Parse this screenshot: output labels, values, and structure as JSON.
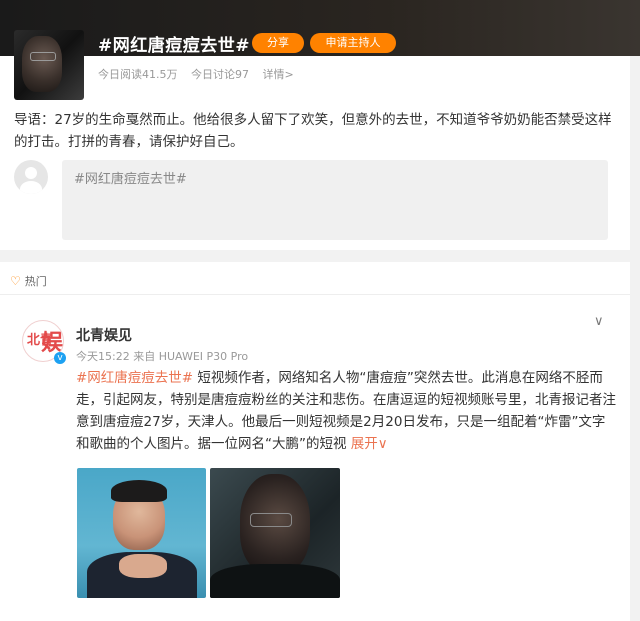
{
  "topic": {
    "title": "#网红唐痘痘去世#",
    "share_label": "分享",
    "host_label": "申请主持人",
    "stats": {
      "reads": "今日阅读41.5万",
      "discussions": "今日讨论97",
      "details": "详情>"
    },
    "intro": "导语：27岁的生命戛然而止。他给很多人留下了欢笑，但意外的去世，不知道爷爷奶奶能否禁受这样的打击。打拼的青春，请保护好自己。",
    "comment_placeholder": "#网红唐痘痘去世#"
  },
  "hot_section": {
    "label": "热门"
  },
  "post": {
    "author": "北青娱见",
    "logo_text_a": "北青",
    "logo_text_b": "娱",
    "meta": "今天15:22 来自 HUAWEI P30 Pro",
    "tag": "#网红唐痘痘去世#",
    "body": " 短视频作者，网络知名人物“唐痘痘”突然去世。此消息在网络不胫而走，引起网友，特别是唐痘痘粉丝的关注和悲伤。在唐逗逗的短视频账号里，北青报记者注意到唐痘痘27岁，天津人。他最后一则短视频是2月20日发布，只是一组配着“炸雷”文字和歌曲的个人图片。据一位网名“大鹏”的短视",
    "expand": "展开∨"
  },
  "icons": {
    "cover_image": "person-portrait-image",
    "avatar": "default-avatar-icon",
    "verified": "verified-badge-icon",
    "chevron": "chevron-down-icon",
    "hot": "heart-icon"
  },
  "colors": {
    "accent": "#ff8200",
    "link": "#eb7350"
  }
}
